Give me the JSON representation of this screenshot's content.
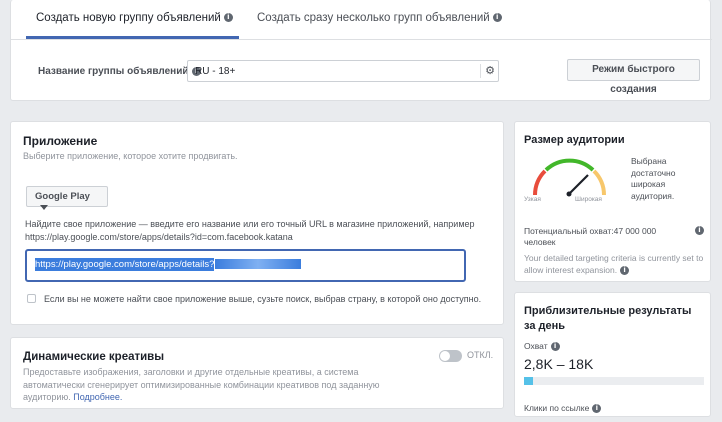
{
  "tabs": {
    "create_one": "Создать новую группу объявлений",
    "create_many": "Создать сразу несколько групп объявлений"
  },
  "adset_name": {
    "label": "Название группы объявлений",
    "value": "RU - 18+",
    "gear_icon": "gear-icon"
  },
  "quick_create_button": "Режим быстрого создания",
  "app": {
    "title": "Приложение",
    "subtitle": "Выберите приложение, которое хотите продвигать.",
    "store_selector": "Google Play",
    "hint": "Найдите свое приложение — введите его название или его точный URL в магазине приложений, например https://play.google.com/store/apps/details?id=com.facebook.katana",
    "url_value": "https://play.google.com/store/apps/details?",
    "checkbox_label": "Если вы не можете найти свое приложение выше, сузьте поиск, выбрав страну, в которой оно доступно."
  },
  "dynamic": {
    "title": "Динамические креативы",
    "description": "Предоставьте изображения, заголовки и другие отдельные креативы, а система автоматически сгенерирует оптимизированные комбинации креативов под заданную аудиторию.",
    "link": "Подробнее.",
    "toggle_state": "ОТКЛ."
  },
  "audience": {
    "title": "Размер аудитории",
    "gauge_narrow": "Узкая",
    "gauge_wide": "Широкая",
    "description": "Выбрана достаточно широкая аудитория.",
    "potential_reach": "Потенциальный охват:47 000 000 человек",
    "note": "Your detailed targeting criteria is currently set to allow interest expansion."
  },
  "results": {
    "title": "Приблизительные результаты за день",
    "reach_label": "Охват",
    "reach_value": "2,8K – 18K",
    "reach_fraction": 0.05,
    "clicks_label": "Клики по ссылке"
  },
  "colors": {
    "accent": "#4267b2",
    "selection": "#3b7ddd",
    "bar_fill": "#55c1e8"
  }
}
